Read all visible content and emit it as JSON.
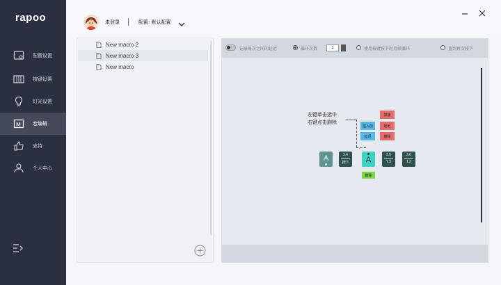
{
  "app": {
    "logo": "rapoo"
  },
  "sidebar": {
    "items": [
      {
        "label": "配置设置",
        "icon": "settings-screen-icon",
        "active": false
      },
      {
        "label": "按键设置",
        "icon": "keyboard-icon",
        "active": false
      },
      {
        "label": "灯光设置",
        "icon": "bulb-icon",
        "active": false
      },
      {
        "label": "宏编辑",
        "icon": "macro-icon",
        "active": true
      },
      {
        "label": "支持",
        "icon": "thumbs-up-icon",
        "active": false
      },
      {
        "label": "个人中心",
        "icon": "user-icon",
        "active": false
      }
    ],
    "collapse_icon": "menu-collapse-icon"
  },
  "header": {
    "user_name": "未登录",
    "config_label": "配置: 默认配置"
  },
  "macros": {
    "items": [
      {
        "label": "New macro 2",
        "selected": false
      },
      {
        "label": "New macro 3",
        "selected": true
      },
      {
        "label": "New macro",
        "selected": false
      }
    ]
  },
  "editor": {
    "toggle_text": "记录每次之间的延迟",
    "option_repeat": "循环次数",
    "repeat_count": "1",
    "option_hold": "使用按键按下时持续循环",
    "option_until": "直到再次按下",
    "annotation_line1": "左键单击选中",
    "annotation_line2": "右键点击删除",
    "chips": {
      "red1": "加速",
      "red2": "延迟",
      "red3": "删除",
      "blue1": "插入前",
      "blue2": "延迟",
      "green": "删除"
    },
    "keys": {
      "k1_glyph": "A",
      "k2_top": "3.4",
      "k2_bot": "按下",
      "k3_glyph": "A",
      "k4_top": "3.5",
      "k4_bot": "Y.3",
      "k5_top": "3.0",
      "k5_bot": "1.3"
    }
  },
  "colors": {
    "sidebar_bg": "#2b3040",
    "accent_teal": "#3fd1c1",
    "chip_red": "#e66c6c",
    "chip_blue": "#56b6e9",
    "chip_green": "#7ad84a"
  }
}
